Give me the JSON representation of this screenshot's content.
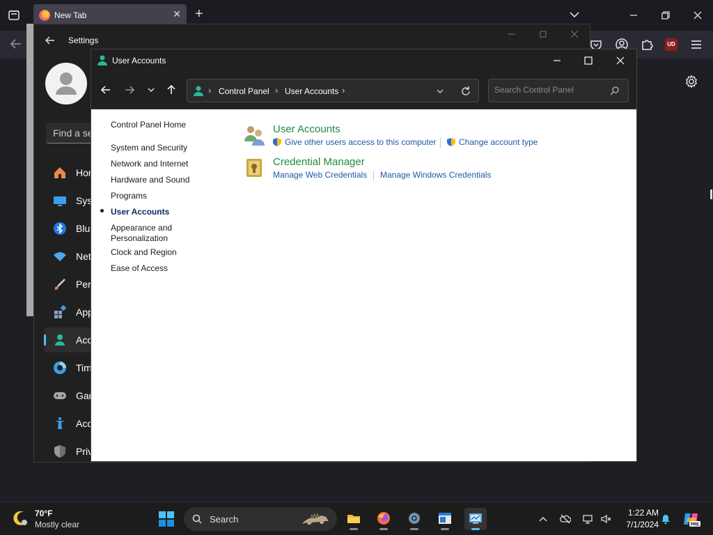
{
  "firefox": {
    "tab_title": "New Tab",
    "ublock_label": "UD"
  },
  "settings": {
    "title": "Settings",
    "search_placeholder": "Find a se",
    "nav_items": [
      {
        "label": "Hom",
        "icon": "home-icon"
      },
      {
        "label": "Syst",
        "icon": "system-icon"
      },
      {
        "label": "Blue",
        "icon": "bluetooth-icon"
      },
      {
        "label": "Net",
        "icon": "network-icon"
      },
      {
        "label": "Pers",
        "icon": "personalization-icon"
      },
      {
        "label": "App",
        "icon": "apps-icon"
      },
      {
        "label": "Acc",
        "icon": "accounts-icon",
        "selected": true
      },
      {
        "label": "Tim",
        "icon": "time-icon"
      },
      {
        "label": "Gar",
        "icon": "gaming-icon"
      },
      {
        "label": "Acc",
        "icon": "accessibility-icon"
      },
      {
        "label": "Priv",
        "icon": "privacy-icon"
      }
    ],
    "accent_color": "#4cc2ff"
  },
  "control_panel": {
    "window_title": "User Accounts",
    "breadcrumb": [
      "Control Panel",
      "User Accounts"
    ],
    "search_placeholder": "Search Control Panel",
    "left_nav": {
      "home": "Control Panel Home",
      "items": [
        "System and Security",
        "Network and Internet",
        "Hardware and Sound",
        "Programs",
        "User Accounts",
        "Appearance and",
        "Personalization",
        "Clock and Region",
        "Ease of Access"
      ]
    },
    "categories": [
      {
        "title": "User Accounts",
        "links": [
          "Give other users access to this computer",
          "Change account type"
        ]
      },
      {
        "title": "Credential Manager",
        "links": [
          "Manage Web Credentials",
          "Manage Windows Credentials"
        ]
      }
    ],
    "heading_color": "#1e8a3d",
    "link_color": "#1f58a6"
  },
  "taskbar": {
    "weather_temp": "70°F",
    "weather_condition": "Mostly clear",
    "search_label": "Search",
    "time": "1:22 AM",
    "date": "7/1/2024",
    "copilot_badge": "PRE"
  }
}
